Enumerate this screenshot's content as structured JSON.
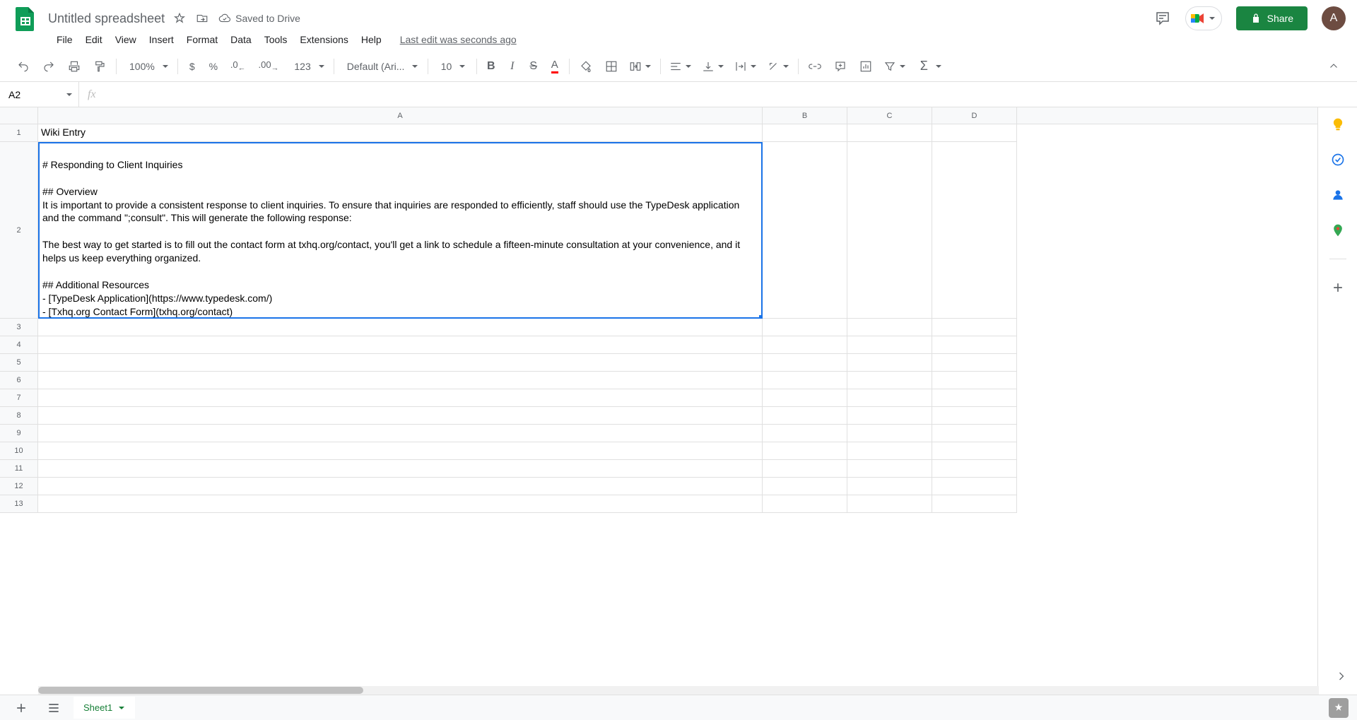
{
  "header": {
    "doc_title": "Untitled spreadsheet",
    "saved_status": "Saved to Drive",
    "share_label": "Share",
    "avatar_initial": "A"
  },
  "menu": {
    "file": "File",
    "edit": "Edit",
    "view": "View",
    "insert": "Insert",
    "format": "Format",
    "data": "Data",
    "tools": "Tools",
    "extensions": "Extensions",
    "help": "Help",
    "last_edit": "Last edit was seconds ago"
  },
  "toolbar": {
    "zoom": "100%",
    "currency": "$",
    "percent": "%",
    "dec_dec": ".0",
    "inc_dec": ".00",
    "more_formats": "123",
    "font": "Default (Ari...",
    "font_size": "10",
    "functions": "Σ"
  },
  "formula": {
    "name_box": "A2",
    "fx": "fx"
  },
  "columns": [
    "A",
    "B",
    "C",
    "D"
  ],
  "rows": [
    "1",
    "2",
    "3",
    "4",
    "5",
    "6",
    "7",
    "8",
    "9",
    "10",
    "11",
    "12",
    "13"
  ],
  "cells": {
    "A1": "Wiki Entry",
    "A2": "\n# Responding to Client Inquiries\n\n## Overview\nIt is important to provide a consistent response to client inquiries. To ensure that inquiries are responded to efficiently, staff should use the TypeDesk application and the command \";consult\". This will generate the following response:\n\nThe best way to get started is to fill out the contact form at txhq.org/contact, you'll get a link to schedule a fifteen-minute consultation at your convenience, and it helps us keep everything organized.\n\n## Additional Resources\n- [TypeDesk Application](https://www.typedesk.com/)\n- [Txhq.org Contact Form](txhq.org/contact)"
  },
  "sheet": {
    "tab_name": "Sheet1"
  }
}
